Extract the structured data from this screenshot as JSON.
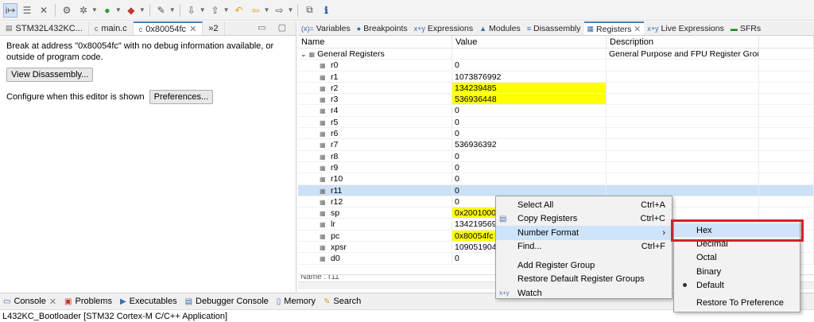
{
  "toolbar": {
    "icons": [
      "instruction-stepping-icon",
      "step-filter-icon",
      "use-step-filter-icon",
      "debug-icon",
      "run-icon",
      "external-tools-icon",
      "build-icon",
      "next-annotation-icon",
      "prev-annotation-icon",
      "back-icon",
      "forward-icon",
      "open-editor-icon",
      "info-icon"
    ]
  },
  "editor": {
    "tabs": [
      {
        "label": "STM32L432KC..."
      },
      {
        "label": "main.c"
      },
      {
        "label": "0x80054fc"
      },
      {
        "label": "»2"
      }
    ],
    "message": "Break at address \"0x80054fc\" with no debug information available, or outside of program code.",
    "view_disassembly": "View Disassembly...",
    "configure_label": "Configure when this editor is shown",
    "preferences_button": "Preferences..."
  },
  "views": {
    "tabs": [
      {
        "label": "Variables",
        "icon": "(x)="
      },
      {
        "label": "Breakpoints",
        "icon": "●"
      },
      {
        "label": "Expressions",
        "icon": "x+y"
      },
      {
        "label": "Modules",
        "icon": "▲"
      },
      {
        "label": "Disassembly",
        "icon": "≡"
      },
      {
        "label": "Registers",
        "icon": "▦"
      },
      {
        "label": "Live Expressions",
        "icon": "x+y"
      },
      {
        "label": "SFRs",
        "icon": "▬"
      }
    ]
  },
  "registers": {
    "columns": {
      "name": "Name",
      "value": "Value",
      "description": "Description"
    },
    "group": {
      "name": "General Registers",
      "description": "General Purpose and FPU Register Group"
    },
    "rows": [
      {
        "name": "r0",
        "value": "0",
        "highlight": false
      },
      {
        "name": "r1",
        "value": "1073876992",
        "highlight": false
      },
      {
        "name": "r2",
        "value": "134239485",
        "highlight": true
      },
      {
        "name": "r3",
        "value": "536936448",
        "highlight": true
      },
      {
        "name": "r4",
        "value": "0",
        "highlight": false
      },
      {
        "name": "r5",
        "value": "0",
        "highlight": false
      },
      {
        "name": "r6",
        "value": "0",
        "highlight": false
      },
      {
        "name": "r7",
        "value": "536936392",
        "highlight": false
      },
      {
        "name": "r8",
        "value": "0",
        "highlight": false
      },
      {
        "name": "r9",
        "value": "0",
        "highlight": false
      },
      {
        "name": "r10",
        "value": "0",
        "highlight": false
      },
      {
        "name": "r11",
        "value": "0",
        "highlight": false
      },
      {
        "name": "r12",
        "value": "0",
        "highlight": false
      },
      {
        "name": "sp",
        "value": "0x20010000",
        "highlight": true
      },
      {
        "name": "lr",
        "value": "134219569",
        "highlight": false
      },
      {
        "name": "pc",
        "value": "0x80054fc",
        "highlight": true
      },
      {
        "name": "xpsr",
        "value": "1090519040",
        "highlight": false
      },
      {
        "name": "d0",
        "value": "0",
        "highlight": false
      }
    ],
    "selected_row": "r11",
    "name_bar": "Name : r11"
  },
  "context_menu": {
    "select_all": "Select All",
    "select_all_sc": "Ctrl+A",
    "copy_registers": "Copy Registers",
    "copy_sc": "Ctrl+C",
    "number_format": "Number Format",
    "find": "Find...",
    "find_sc": "Ctrl+F",
    "add_group": "Add Register Group",
    "restore_groups": "Restore Default Register Groups",
    "watch": "Watch"
  },
  "number_format_menu": {
    "hex": "Hex",
    "decimal": "Decimal",
    "octal": "Octal",
    "binary": "Binary",
    "default": "Default",
    "restore": "Restore To Preference"
  },
  "bottom": {
    "tabs": [
      "Console",
      "Problems",
      "Executables",
      "Debugger Console",
      "Memory",
      "Search"
    ],
    "console_line": "L432KC_Bootloader [STM32 Cortex-M C/C++ Application]"
  },
  "colors": {
    "highlight": "#ffff00",
    "selection": "#cce0f7",
    "annotation_box": "#d0242e"
  }
}
